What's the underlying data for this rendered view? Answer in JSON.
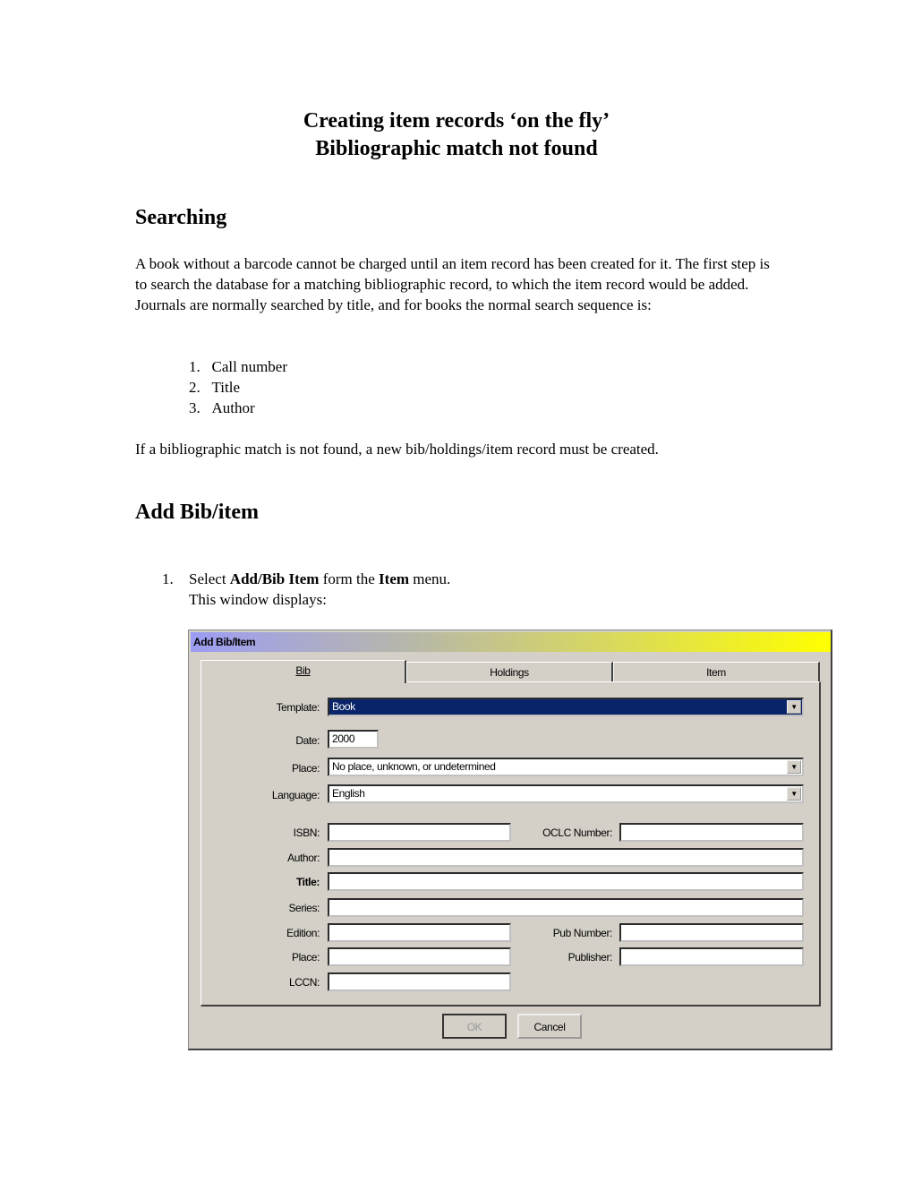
{
  "doc": {
    "title1": "Creating item records ‘on the fly’",
    "title2": "Bibliographic match not found",
    "section1": "Searching",
    "para1": "A book without a barcode cannot be charged until an item record has been created for it. The first step is to search the database for a matching bibliographic record, to which the item record would be added.  Journals are normally searched by title, and for books the normal search sequence is:",
    "search_steps": [
      "Call number",
      "Title",
      "Author"
    ],
    "para2": "If a bibliographic match is not found, a new bib/holdings/item record must be created.",
    "section2": "Add Bib/item",
    "step1": {
      "num": "1.",
      "pre": "Select ",
      "b1": "Add/Bib Item",
      "mid": " form the ",
      "b2": "Item",
      "post": " menu.",
      "line2": "This window displays:"
    }
  },
  "dialog": {
    "title": "Add Bib/Item",
    "tabs": [
      "Bib",
      "Holdings",
      "Item"
    ],
    "active_tab": "Bib",
    "template": {
      "label": "Template:",
      "value": "Book"
    },
    "date": {
      "label": "Date:",
      "value": "2000"
    },
    "place_select": {
      "label": "Place:",
      "value": "No place, unknown, or undetermined"
    },
    "language": {
      "label": "Language:",
      "value": "English"
    },
    "isbn": {
      "label": "ISBN:",
      "value": ""
    },
    "oclc": {
      "label": "OCLC Number:",
      "value": ""
    },
    "author": {
      "label": "Author:",
      "value": ""
    },
    "title_field": {
      "label": "Title:",
      "value": ""
    },
    "series": {
      "label": "Series:",
      "value": ""
    },
    "edition": {
      "label": "Edition:",
      "value": ""
    },
    "pub_number": {
      "label": "Pub Number:",
      "value": ""
    },
    "place": {
      "label": "Place:",
      "value": ""
    },
    "publisher": {
      "label": "Publisher:",
      "value": ""
    },
    "lccn": {
      "label": "LCCN:",
      "value": ""
    },
    "ok": "OK",
    "cancel": "Cancel",
    "colors": {
      "selection": "#0a246a",
      "face": "#d4d0c8"
    }
  }
}
